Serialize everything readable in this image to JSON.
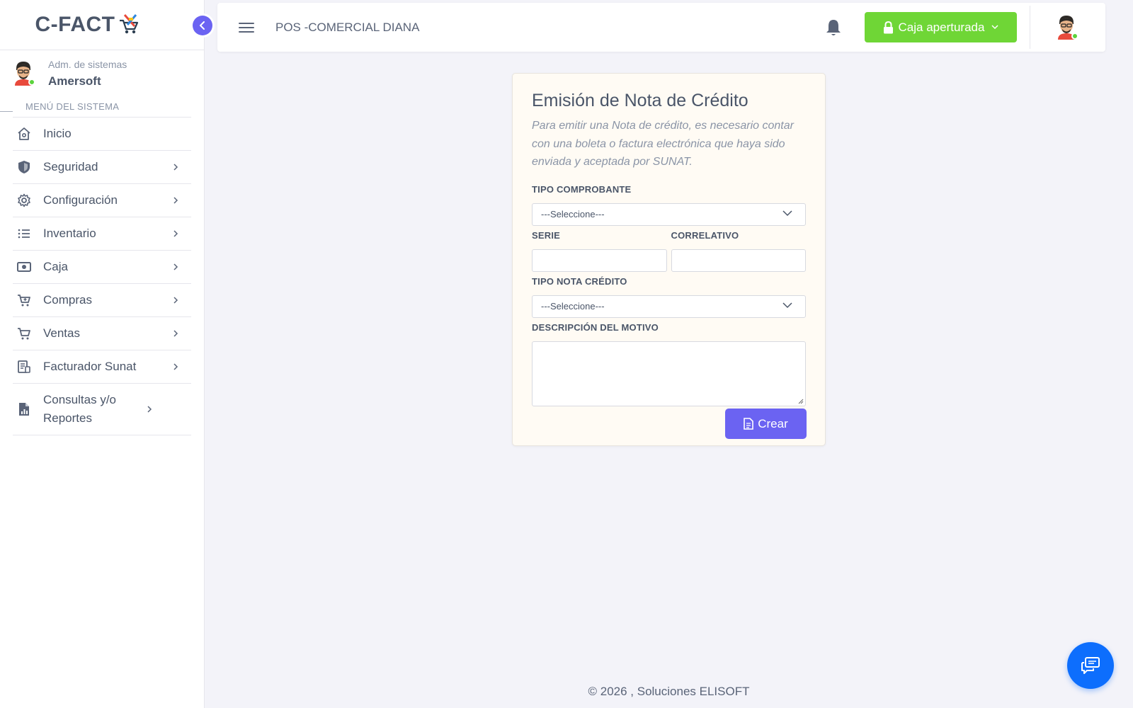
{
  "brand": {
    "name": "C-FACT"
  },
  "user": {
    "role": "Adm. de sistemas",
    "name": "Amersoft"
  },
  "sidebar": {
    "header": "MENÚ DEL SISTEMA",
    "items": [
      {
        "label": "Inicio",
        "icon": "home-icon"
      },
      {
        "label": "Seguridad",
        "icon": "shield-icon"
      },
      {
        "label": "Configuración",
        "icon": "gear-icon"
      },
      {
        "label": "Inventario",
        "icon": "list-icon"
      },
      {
        "label": "Caja",
        "icon": "cash-icon"
      },
      {
        "label": "Compras",
        "icon": "cart-plus-icon"
      },
      {
        "label": "Ventas",
        "icon": "cart-icon"
      },
      {
        "label": "Facturador Sunat",
        "icon": "invoice-icon"
      },
      {
        "label": "Consultas y/o Reportes",
        "icon": "report-icon"
      }
    ]
  },
  "topbar": {
    "store": "POS -COMERCIAL DIANA",
    "caja_label": "Caja aperturada"
  },
  "form": {
    "title": "Emisión de Nota de Crédito",
    "note": "Para emitir una Nota de crédito, es necesario contar con una boleta o factura electrónica que haya sido enviada y aceptada por SUNAT.",
    "tipo_comprobante_label": "TIPO COMPROBANTE",
    "tipo_comprobante_value": "---Seleccione---",
    "serie_label": "SERIE",
    "serie_value": "",
    "correlativo_label": "CORRELATIVO",
    "correlativo_value": "",
    "tipo_nota_label": "TIPO NOTA CRÉDITO",
    "tipo_nota_value": "---Seleccione---",
    "descripcion_label": "DESCRIPCIÓN DEL MOTIVO",
    "descripcion_value": "",
    "crear_label": "Crear"
  },
  "footer": {
    "text": "© 2026 , Soluciones ELISOFT"
  },
  "colors": {
    "accent": "#6b63f2",
    "caja_green": "#6fd636",
    "chat_blue": "#0d6efd",
    "online": "#5bd33c"
  }
}
